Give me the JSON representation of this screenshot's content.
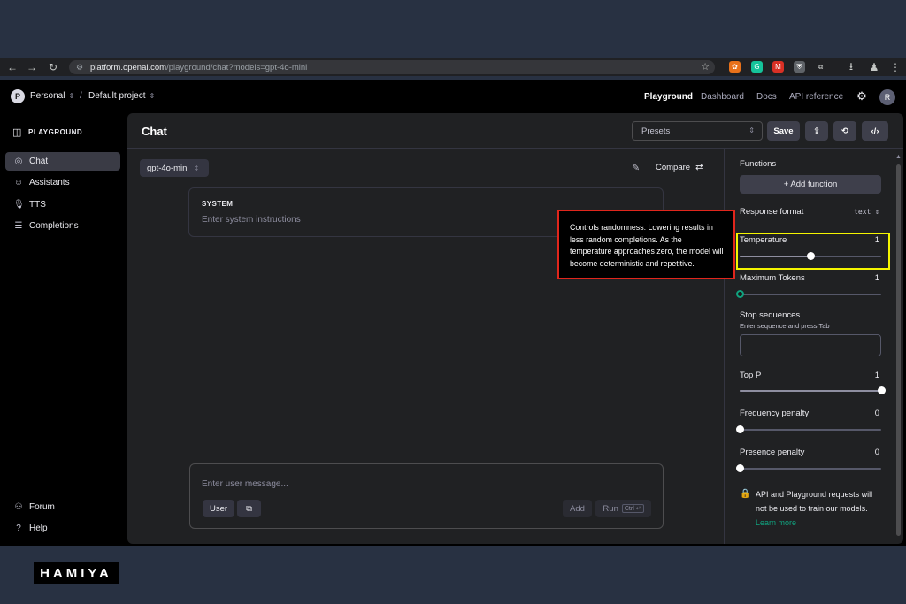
{
  "browser": {
    "url_host": "platform.openai.com",
    "url_path": "/playground/chat?models=gpt-4o-mini",
    "extensions": [
      {
        "name": "puzzle-extension-icon",
        "color": "#e8711a",
        "glyph": "✿"
      },
      {
        "name": "grammarly-icon",
        "color": "#15c39a",
        "glyph": "G"
      },
      {
        "name": "red-extension-icon",
        "color": "#d93025",
        "glyph": "M"
      },
      {
        "name": "shield-extension-icon",
        "color": "#5f6368",
        "glyph": "⛨"
      }
    ]
  },
  "topnav": {
    "org": {
      "initial": "P",
      "name": "Personal"
    },
    "project": "Default project",
    "separator": "/",
    "links": [
      "Playground",
      "Dashboard",
      "Docs",
      "API reference"
    ],
    "user_initial": "R"
  },
  "sidebar": {
    "title": "PLAYGROUND",
    "items": [
      {
        "label": "Chat",
        "icon": "chat-bubble-icon",
        "glyph": "◎",
        "active": true
      },
      {
        "label": "Assistants",
        "icon": "assistants-icon",
        "glyph": "☺",
        "active": false
      },
      {
        "label": "TTS",
        "icon": "microphone-icon",
        "glyph": "🎙",
        "active": false
      },
      {
        "label": "Completions",
        "icon": "lines-icon",
        "glyph": "☰",
        "active": false
      }
    ],
    "footer": [
      {
        "label": "Forum",
        "icon": "people-icon",
        "glyph": "⚇"
      },
      {
        "label": "Help",
        "icon": "help-icon",
        "glyph": "?"
      }
    ]
  },
  "main": {
    "title": "Chat",
    "presets_placeholder": "Presets",
    "save_label": "Save",
    "model": "gpt-4o-mini",
    "compare_label": "Compare",
    "system": {
      "label": "SYSTEM",
      "placeholder": "Enter system instructions"
    },
    "message": {
      "placeholder": "Enter user message...",
      "role_label": "User",
      "add_label": "Add",
      "run_label": "Run",
      "run_shortcut": "Ctrl ↵"
    }
  },
  "settings": {
    "functions_label": "Functions",
    "add_function_label": "+ Add function",
    "response_format_label": "Response format",
    "response_format_value": "text",
    "temperature": {
      "label": "Temperature",
      "value": "1",
      "level": 0.5
    },
    "max_tokens": {
      "label": "Maximum Tokens",
      "value": "1",
      "level": 0.0
    },
    "stop_sequences": {
      "label": "Stop sequences",
      "hint": "Enter sequence and press Tab"
    },
    "top_p": {
      "label": "Top P",
      "value": "1",
      "level": 1.0
    },
    "frequency_penalty": {
      "label": "Frequency penalty",
      "value": "0",
      "level": 0.0
    },
    "presence_penalty": {
      "label": "Presence penalty",
      "value": "0",
      "level": 0.0
    },
    "notice": "API and Playground requests will not be used to train our models.",
    "learn_more": "Learn more"
  },
  "tooltip": {
    "text": "Controls randomness: Lowering results in less random completions. As the temperature approaches zero, the model will become deterministic and repetitive."
  },
  "colors": {
    "highlight_yellow": "#f5f500",
    "highlight_red": "#e0261c",
    "accent_green": "#10a37f"
  },
  "watermark": "HAMIYA"
}
